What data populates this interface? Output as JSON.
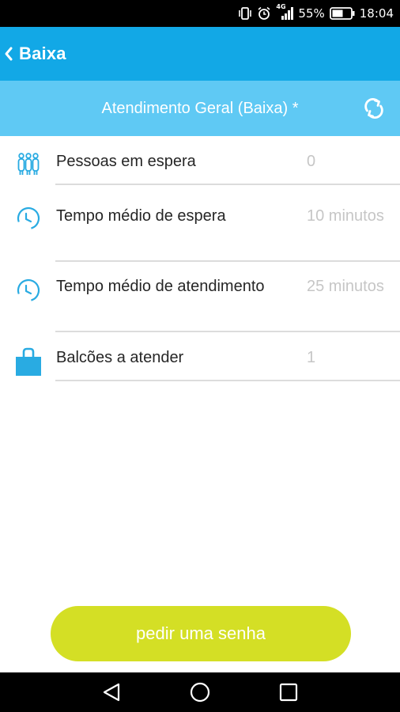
{
  "status_bar": {
    "vibrate_icon": "vibrate-icon",
    "alarm_icon": "alarm-icon",
    "network": "4G",
    "battery": "55%",
    "time": "18:04"
  },
  "app_bar": {
    "back_icon": "chevron-left-icon",
    "title": "Baixa"
  },
  "sub_header": {
    "title": "Atendimento Geral (Baixa) *",
    "refresh_icon": "refresh-icon"
  },
  "rows": [
    {
      "icon": "people-icon",
      "label": "Pessoas em espera",
      "value": "0"
    },
    {
      "icon": "clock-icon",
      "label": "Tempo médio de espera",
      "value": "10 minutos"
    },
    {
      "icon": "clock-icon",
      "label": "Tempo médio de atendimento",
      "value": "25 minutos"
    },
    {
      "icon": "briefcase-icon",
      "label": "Balcões a atender",
      "value": "1"
    }
  ],
  "request_button": {
    "label": "pedir uma senha"
  },
  "nav_bar": {
    "back": "back-triangle-icon",
    "home": "home-circle-icon",
    "recents": "recents-square-icon"
  },
  "colors": {
    "app_bar": "#12a8e6",
    "sub_header": "#5fc9f4",
    "button": "#d4df25",
    "icon": "#29abe2",
    "value_text": "#c6c6c6"
  }
}
